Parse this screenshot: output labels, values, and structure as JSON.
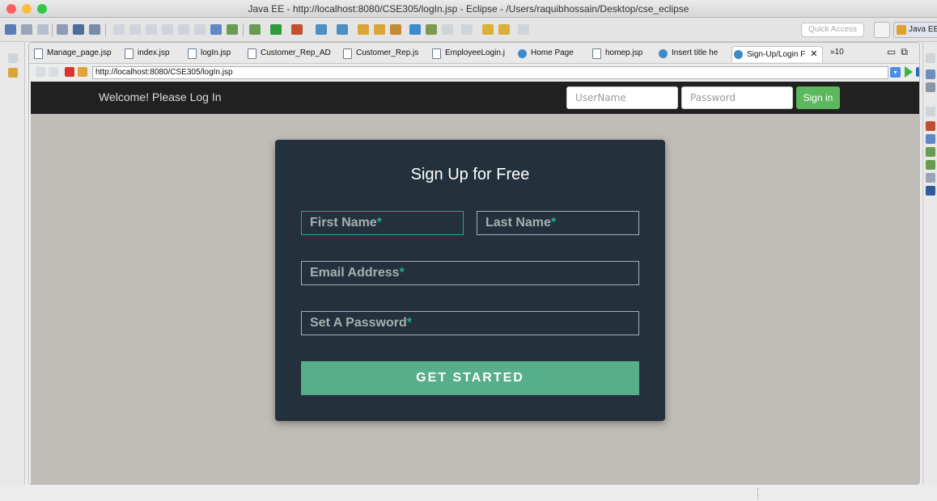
{
  "window": {
    "title": "Java EE - http://localhost:8080/CSE305/logIn.jsp - Eclipse - /Users/raquibhossain/Desktop/cse_eclipse"
  },
  "toolbar": {
    "quick_access_placeholder": "Quick Access",
    "perspective_label": "Java EE"
  },
  "editor_tabs": [
    {
      "label": "Manage_page.jsp",
      "icon": "file-icon"
    },
    {
      "label": "index.jsp",
      "icon": "file-icon"
    },
    {
      "label": "logIn.jsp",
      "icon": "file-icon"
    },
    {
      "label": "Customer_Rep_AD",
      "icon": "file-icon"
    },
    {
      "label": "Customer_Rep.js",
      "icon": "file-icon"
    },
    {
      "label": "EmployeeLogin.j",
      "icon": "file-icon"
    },
    {
      "label": "Home Page",
      "icon": "globe-icon"
    },
    {
      "label": "homep.jsp",
      "icon": "file-icon"
    },
    {
      "label": "Insert title he",
      "icon": "globe-icon"
    },
    {
      "label": "Sign-Up/Login F",
      "icon": "globe-icon",
      "active": true
    }
  ],
  "tab_overflow": "»10",
  "tab_close_glyph": "✕",
  "browser": {
    "url": "http://localhost:8080/CSE305/logIn.jsp"
  },
  "page": {
    "navbar": {
      "welcome": "Welcome! Please Log In",
      "username_placeholder": "UserName",
      "password_placeholder": "Password",
      "signin_label": "Sign in"
    },
    "signup": {
      "title": "Sign Up for Free",
      "first_name": "First Name",
      "last_name": "Last Name",
      "email": "Email Address",
      "password": "Set A Password",
      "required_mark": "*",
      "button": "GET STARTED"
    }
  },
  "colors": {
    "navbar_bg": "#212121",
    "page_bg": "#c0bcb8",
    "card_bg": "#24303c",
    "accent": "#1ab188",
    "button_bg": "#56ae8a",
    "signin_bg": "#5cb85c"
  }
}
